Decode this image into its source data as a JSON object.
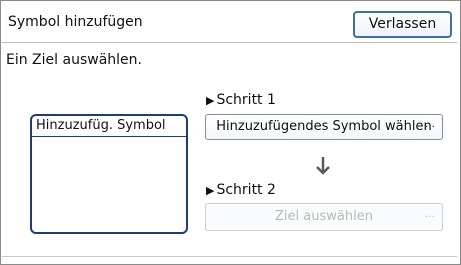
{
  "header": {
    "title": "Symbol hinzufügen",
    "exit_label": "Verlassen"
  },
  "instruction": "Ein Ziel auswählen.",
  "box": {
    "header": "Hinzuzufüg. Symbol"
  },
  "step1": {
    "label": "Schritt 1",
    "button_label": "Hinzuzufügendes Symbol wählen"
  },
  "step2": {
    "label": "Schritt 2",
    "button_label": "Ziel auswählen"
  },
  "icons": {
    "step_marker": "triangle-right-icon",
    "flow": "down-arrow-icon",
    "more": "ellipsis-icon"
  }
}
